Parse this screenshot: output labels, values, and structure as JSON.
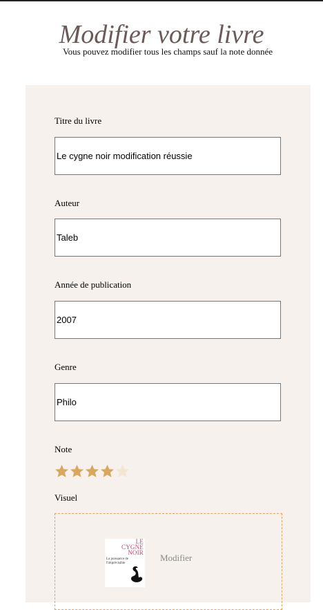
{
  "header": {
    "title": "Modifier votre livre",
    "subtitle": "Vous pouvez modifier tous les champs sauf la note donnée"
  },
  "form": {
    "title_label": "Titre du livre",
    "title_value": "Le cygne noir modification réussie",
    "author_label": "Auteur",
    "author_value": "Taleb",
    "year_label": "Année de publication",
    "year_value": "2007",
    "genre_label": "Genre",
    "genre_value": "Philo",
    "rating_label": "Note",
    "rating": {
      "value": 4,
      "max": 5
    },
    "visual_label": "Visuel",
    "modify_label": "Modifier"
  },
  "cover": {
    "title_line1": "LE",
    "title_line2": "CYGNE",
    "title_line3": "NOIR",
    "subtitle": "La puissance de l'imprévisible"
  },
  "colors": {
    "panel_bg": "#f6f1ec",
    "star_filled": "#d9a860",
    "star_empty": "#f2e6d3",
    "title_color": "#6b5a57",
    "dropzone_border": "#e0a260",
    "cover_accent": "#c8436f"
  },
  "icons": {
    "star": "star-icon",
    "swan": "swan-icon"
  }
}
